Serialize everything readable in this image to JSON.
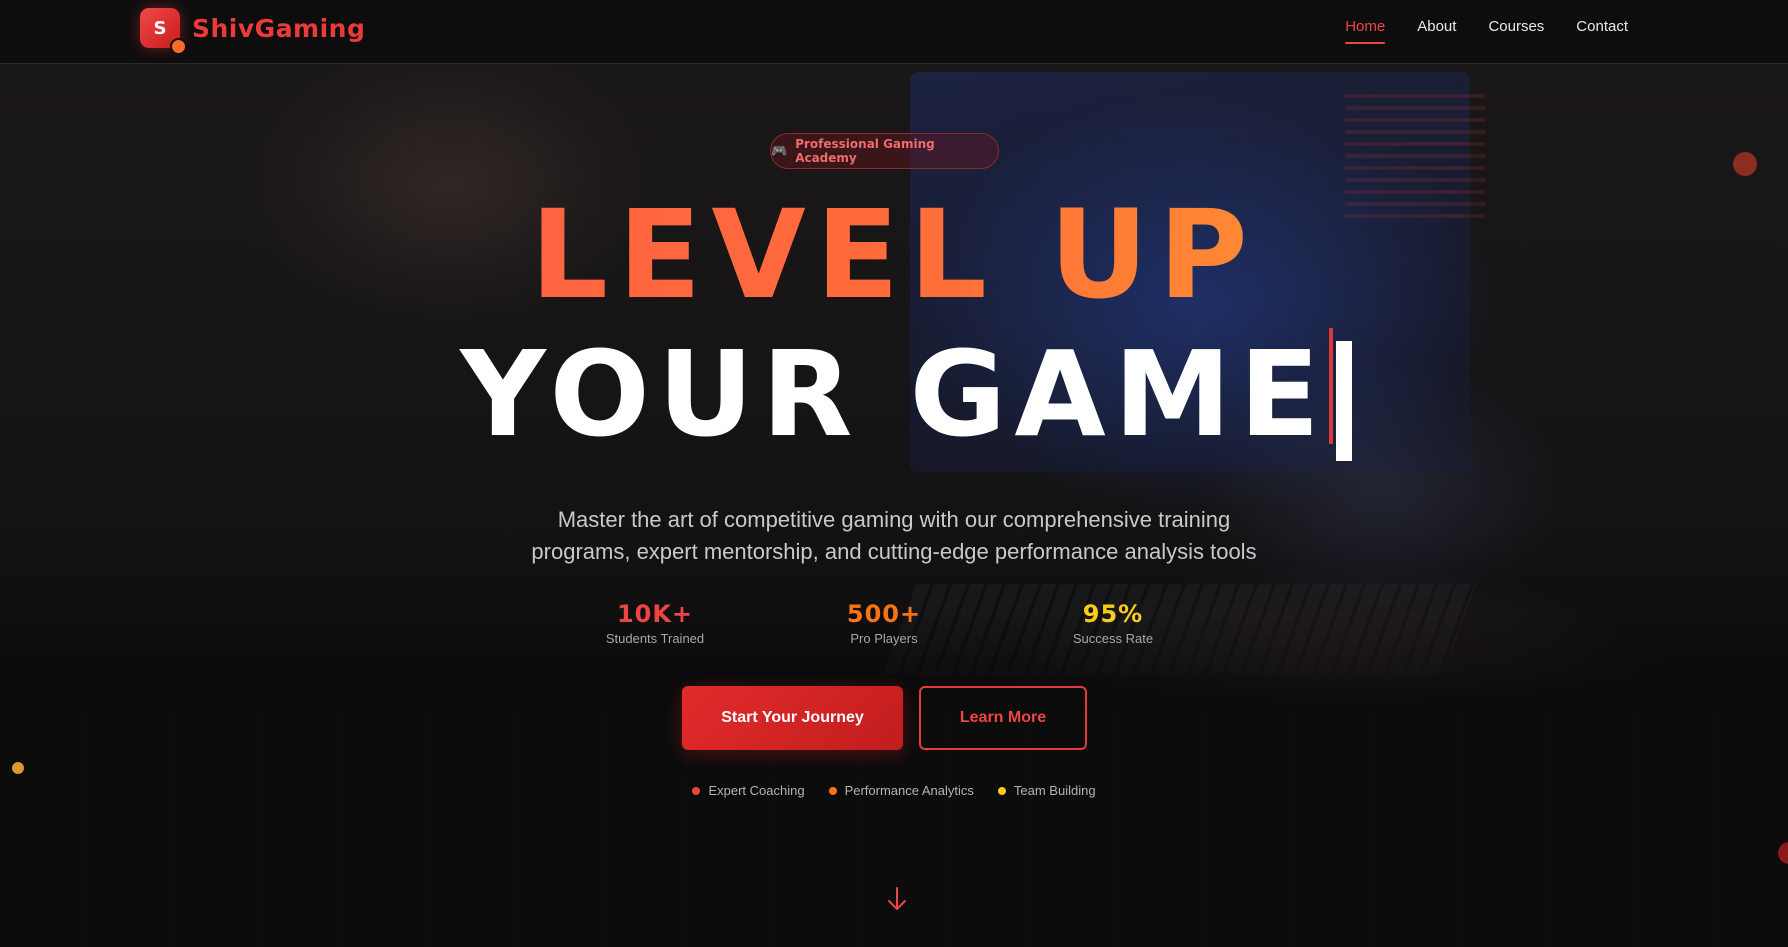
{
  "header": {
    "logo_letter": "S",
    "logo_text": "ShivGaming",
    "nav": [
      {
        "label": "Home",
        "active": true
      },
      {
        "label": "About",
        "active": false
      },
      {
        "label": "Courses",
        "active": false
      },
      {
        "label": "Contact",
        "active": false
      }
    ]
  },
  "hero": {
    "badge": {
      "icon": "gamepad-icon",
      "label": "Professional Gaming Academy"
    },
    "headline_line1": "LEVEL UP",
    "headline_line2": "YOUR GAME",
    "subtitle_line1": "Master the art of competitive gaming with our comprehensive training",
    "subtitle_line2": "programs, expert mentorship, and cutting-edge performance analysis tools",
    "stats": [
      {
        "value": "10K+",
        "label": "Students Trained",
        "color": "#ef4444"
      },
      {
        "value": "500+",
        "label": "Pro Players",
        "color": "#f97316"
      },
      {
        "value": "95%",
        "label": "Success Rate",
        "color": "#facc15"
      }
    ],
    "primary_button": "Start Your Journey",
    "secondary_button": "Learn More",
    "features": [
      {
        "label": "Expert Coaching",
        "color": "#ef4444"
      },
      {
        "label": "Performance Analytics",
        "color": "#f97316"
      },
      {
        "label": "Team Building",
        "color": "#facc15"
      }
    ],
    "scroll_icon": "arrow-down-icon"
  },
  "colors": {
    "accent": "#ef4444",
    "orange": "#f97316",
    "yellow": "#facc15",
    "background": "#0b0b0c"
  }
}
